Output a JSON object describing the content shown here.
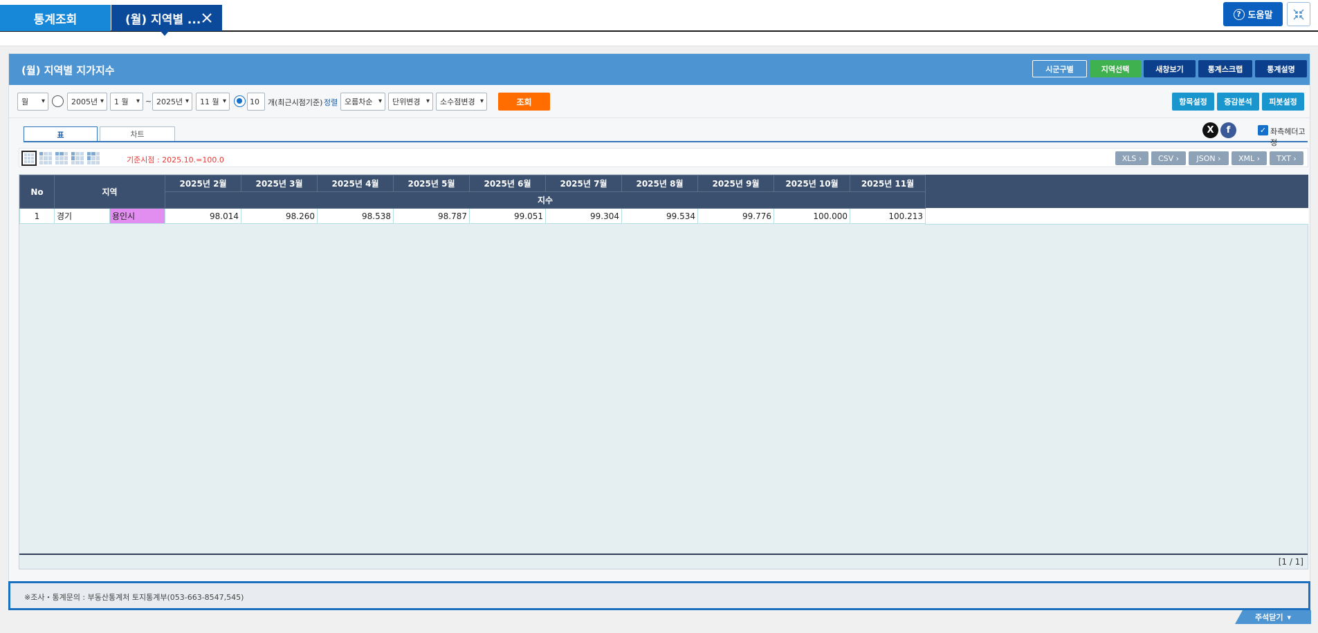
{
  "top_tabs": {
    "main": "통계조회",
    "active": "(월) 지역별 ..."
  },
  "header_actions": {
    "help": "도움말"
  },
  "panel": {
    "title": "(월) 지역별 지가지수",
    "buttons": [
      "시군구별",
      "지역선택",
      "새창보기",
      "통계스크랩",
      "통계설명"
    ]
  },
  "filters": {
    "period": "월",
    "start_year": "2005년",
    "start_month": "1 월",
    "tilde": "~",
    "end_year": "2025년",
    "end_month": "11 월",
    "recent_count": "10",
    "recent_label": "개(최근시점기준)",
    "sort_label": "정렬",
    "sort_value": "오름차순",
    "unit_value": "단위변경",
    "decimal_value": "소수점변경",
    "search_button": "조회",
    "right_buttons": [
      "항목설정",
      "증감분석",
      "피봇설정"
    ]
  },
  "view_tabs": {
    "table": "표",
    "chart": "차트"
  },
  "social": {
    "x": "X",
    "facebook": "f"
  },
  "fix_header_label": "좌측헤더고정",
  "base_note": "기준시점 : 2025.10.=100.0",
  "export_buttons": [
    "XLS",
    "CSV",
    "JSON",
    "XML",
    "TXT"
  ],
  "table": {
    "col_no": "No",
    "col_region": "지역",
    "months": [
      "2025년 2월",
      "2025년 3월",
      "2025년 4월",
      "2025년 5월",
      "2025년 6월",
      "2025년 7월",
      "2025년 8월",
      "2025년 9월",
      "2025년 10월",
      "2025년 11월"
    ],
    "subheader": "지수",
    "rows": [
      {
        "no": "1",
        "region1": "경기",
        "region2": "용인시",
        "values": [
          "98.014",
          "98.260",
          "98.538",
          "98.787",
          "99.051",
          "99.304",
          "99.534",
          "99.776",
          "100.000",
          "100.213"
        ]
      }
    ],
    "pager": "[1 / 1]"
  },
  "notice": "※조사・통계문의 : 부동산통계처 토지통계부(053-663-8547,545)",
  "fold_button": "주석닫기"
}
